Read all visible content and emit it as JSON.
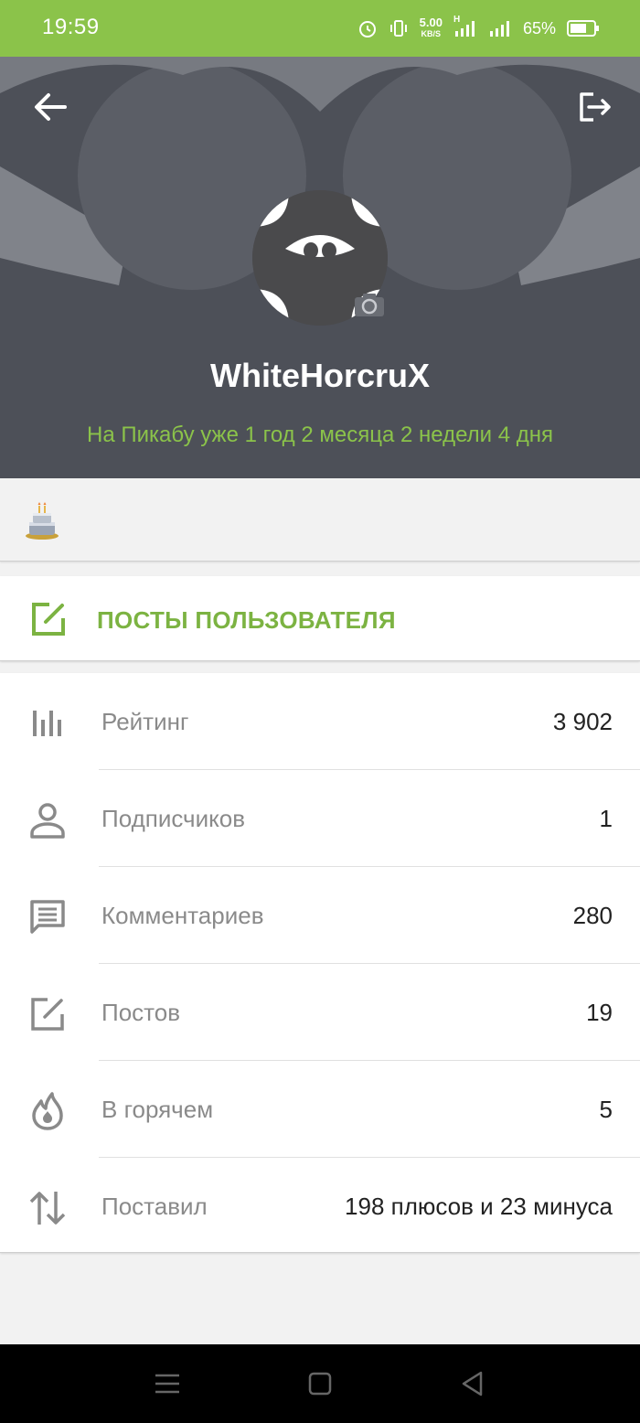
{
  "status_bar": {
    "time": "19:59",
    "net_speed_value": "5.00",
    "net_speed_unit": "KB/S",
    "network_type": "H",
    "battery_percent": "65%"
  },
  "profile": {
    "username": "WhiteHorcruX",
    "tenure": "На Пикабу уже 1 год 2 месяца 2 недели 4 дня"
  },
  "posts_button": {
    "label": "ПОСТЫ ПОЛЬЗОВАТЕЛЯ"
  },
  "stats": [
    {
      "label": "Рейтинг",
      "value": "3 902",
      "icon": "bar-chart-icon"
    },
    {
      "label": "Подписчиков",
      "value": "1",
      "icon": "person-icon"
    },
    {
      "label": "Комментариев",
      "value": "280",
      "icon": "comment-icon"
    },
    {
      "label": "Постов",
      "value": "19",
      "icon": "edit-icon"
    },
    {
      "label": "В горячем",
      "value": "5",
      "icon": "flame-icon"
    },
    {
      "label": "Поставил",
      "value": "198 плюсов и 23 минуса",
      "icon": "up-down-arrows-icon"
    }
  ],
  "colors": {
    "accent_green": "#8bc34a",
    "header_bg": "#4d5058"
  }
}
